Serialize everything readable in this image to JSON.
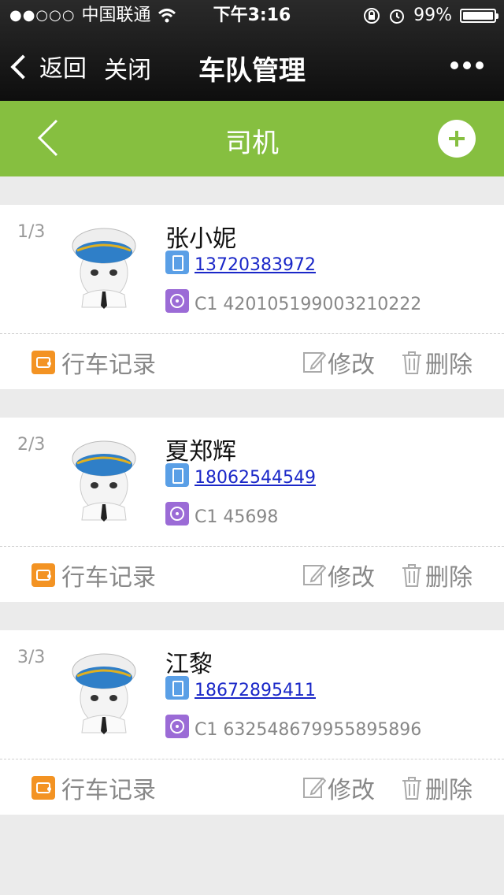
{
  "status_bar": {
    "carrier": "中国联通",
    "time": "下午3:16",
    "battery": "99%",
    "battery_level": 0.99
  },
  "nav": {
    "back_label": "返回",
    "close_label": "关闭",
    "title": "车队管理"
  },
  "header": {
    "title": "司机"
  },
  "drivers": [
    {
      "index": "1/3",
      "name": "张小妮",
      "phone": "13720383972",
      "license": "C1 420105199003210222"
    },
    {
      "index": "2/3",
      "name": "夏郑辉",
      "phone": "18062544549",
      "license": "C1 45698"
    },
    {
      "index": "3/3",
      "name": "江黎",
      "phone": "18672895411",
      "license": "C1 632548679955895896"
    }
  ],
  "actions": {
    "record_label": "行车记录",
    "edit_label": "修改",
    "delete_label": "删除"
  },
  "colors": {
    "green": "#86bf40",
    "link": "#1a27c8",
    "phone_icon": "#5a9fe6",
    "license_icon": "#9b6bd6",
    "record_icon": "#f39323"
  }
}
